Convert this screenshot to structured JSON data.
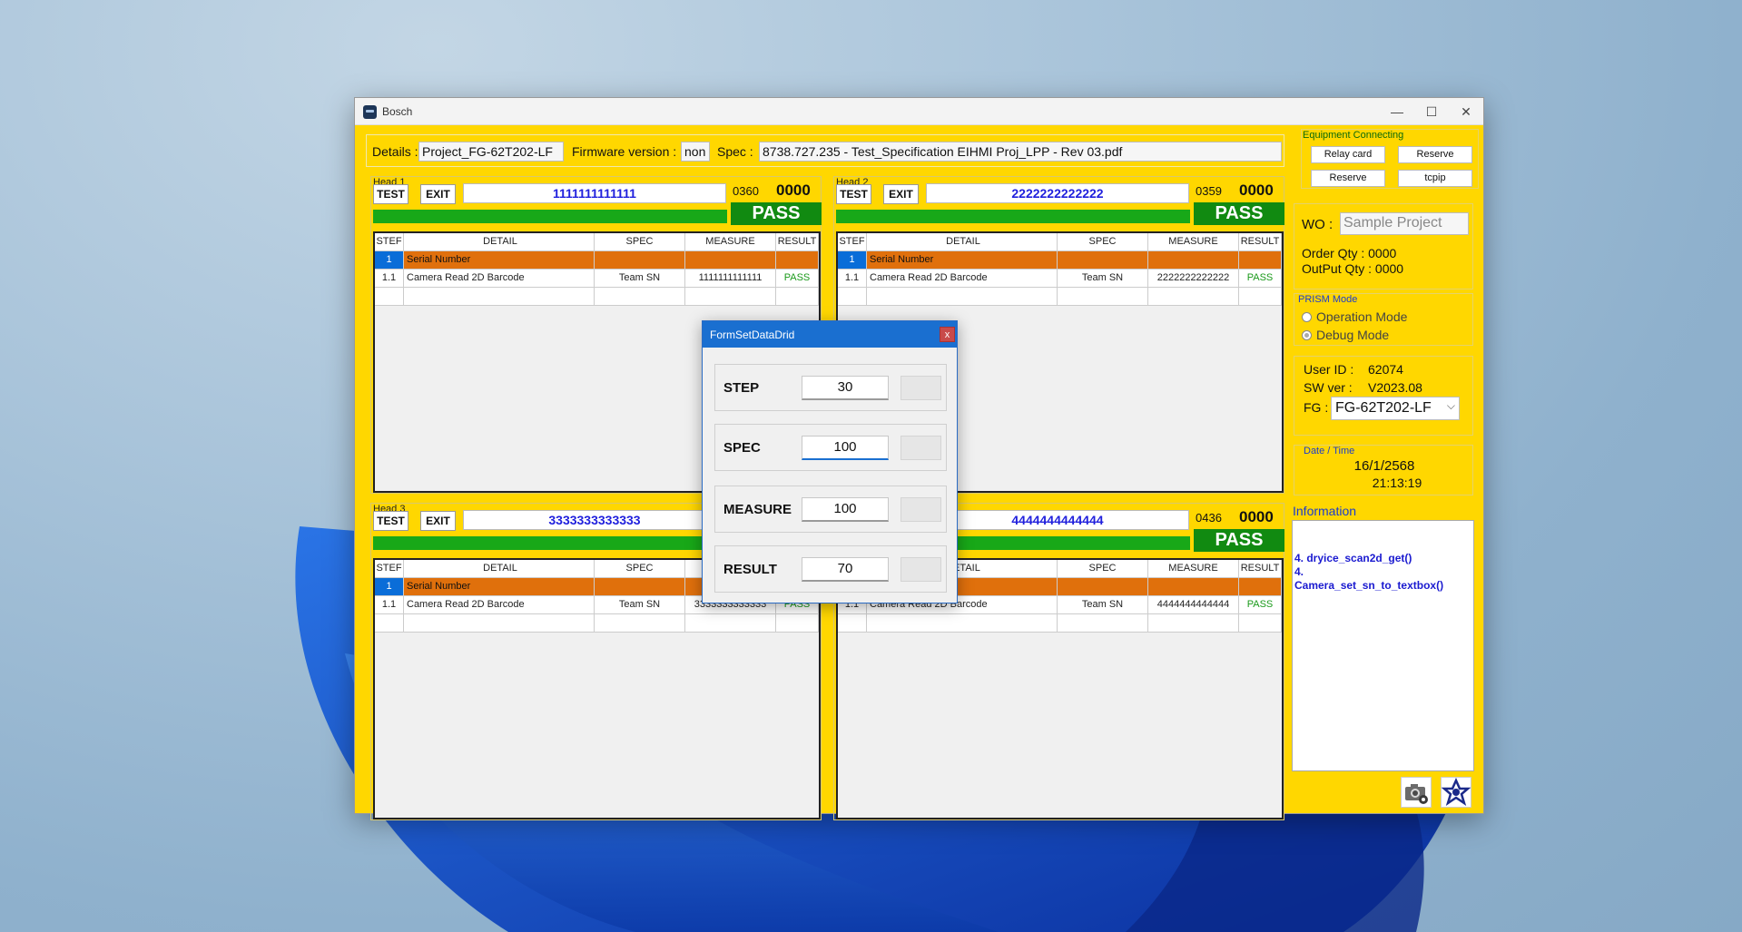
{
  "window": {
    "title": "Bosch",
    "minimize": "—",
    "maximize": "☐",
    "close": "✕"
  },
  "details": {
    "details_label": "Details :",
    "details_value": "Project_FG-62T202-LF",
    "firmware_label": "Firmware version :",
    "firmware_value": "non",
    "spec_label": "Spec :",
    "spec_value": "8738.727.235 - Test_Specification EIHMI Proj_LPP - Rev 03.pdf"
  },
  "grid_columns": [
    "STEF",
    "DETAIL",
    "SPEC",
    "MEASURE",
    "RESULT"
  ],
  "heads": [
    {
      "title": "Head 1",
      "test": "TEST",
      "exit": "EXIT",
      "serial": "1111111111111",
      "count_small": "0360",
      "count_big": "0000",
      "status": "PASS",
      "rows": [
        [
          "1",
          "Serial Number",
          "",
          "",
          ""
        ],
        [
          "1.1",
          "Camera Read 2D Barcode",
          "Team SN",
          "1111111111111",
          "PASS"
        ]
      ]
    },
    {
      "title": "Head 2",
      "test": "TEST",
      "exit": "EXIT",
      "serial": "2222222222222",
      "count_small": "0359",
      "count_big": "0000",
      "status": "PASS",
      "rows": [
        [
          "1",
          "Serial Number",
          "",
          "",
          ""
        ],
        [
          "1.1",
          "Camera Read 2D Barcode",
          "Team SN",
          "2222222222222",
          "PASS"
        ]
      ]
    },
    {
      "title": "Head 3",
      "test": "TEST",
      "exit": "EXIT",
      "serial": "3333333333333",
      "count_small": "",
      "count_big": "",
      "status": "",
      "rows": [
        [
          "1",
          "Serial Number",
          "",
          "",
          ""
        ],
        [
          "1.1",
          "Camera Read 2D Barcode",
          "Team SN",
          "3333333333333",
          "PASS"
        ]
      ]
    },
    {
      "title": "",
      "test": "",
      "exit": "",
      "serial": "4444444444444",
      "count_small": "0436",
      "count_big": "0000",
      "status": "PASS",
      "rows": [
        [
          "1",
          "Serial Number",
          "",
          "",
          ""
        ],
        [
          "1.1",
          "Camera Read 2D Barcode",
          "Team SN",
          "4444444444444",
          "PASS"
        ]
      ]
    }
  ],
  "equipment": {
    "label": "Equipment Connecting",
    "buttons": [
      "Relay card",
      "Reserve",
      "Reserve",
      "tcpip"
    ]
  },
  "wo": {
    "label": "WO :",
    "placeholder": "Sample Project",
    "order_qty": "Order Qty : 0000",
    "output_qty": "OutPut Qty : 0000"
  },
  "prism": {
    "label": "PRISM Mode",
    "options": [
      "Operation Mode",
      "Debug Mode"
    ],
    "selected": "Debug Mode"
  },
  "user": {
    "userid_label": "User ID :",
    "userid_value": "62074",
    "swver_label": "SW ver :",
    "swver_value": "V2023.08",
    "fg_label": "FG :",
    "fg_value": "FG-62T202-LF"
  },
  "datetime": {
    "label": "Date / Time",
    "date": "16/1/2568",
    "time": "21:13:19"
  },
  "information": {
    "label": "Information",
    "line1": "4. dryice_scan2d_get()",
    "line2": "4.",
    "line3": "Camera_set_sn_to_textbox()"
  },
  "icons": {
    "camera": "camera-settings-icon",
    "settings": "settings-star-icon"
  },
  "dialog": {
    "title": "FormSetDataDrid",
    "close": "x",
    "fields": [
      {
        "label": "STEP",
        "value": "30"
      },
      {
        "label": "SPEC",
        "value": "100"
      },
      {
        "label": "MEASURE",
        "value": "100"
      },
      {
        "label": "RESULT",
        "value": "70"
      }
    ]
  },
  "colors": {
    "panel": "#ffd700",
    "pass": "#118a11",
    "serial_row": "#e0700c",
    "selected_cell": "#0a6dd8",
    "serial_text": "#2020dd",
    "dialog_title": "#1a6fd0"
  }
}
